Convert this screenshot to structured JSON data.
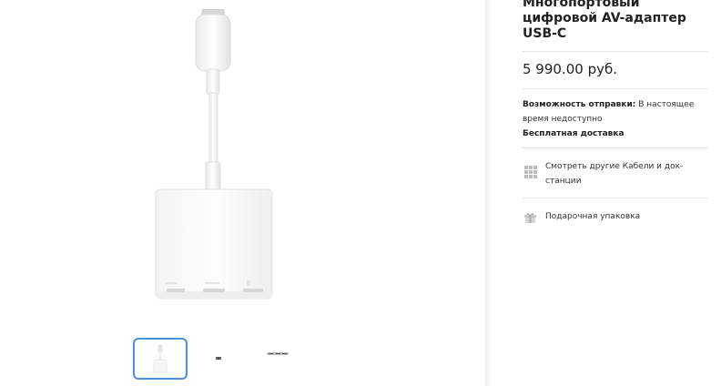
{
  "product": {
    "title_line1": "Многопортовый",
    "title_line2": "цифровой AV-адаптер",
    "title_line3": "USB-C",
    "price": "5 990.00 руб.",
    "shipping_label": "Возможность отправки:",
    "shipping_value_1": "В настоящее",
    "shipping_value_2": "время недоступно",
    "free_delivery": "Бесплатная доставка",
    "browse_link_1": "Смотреть другие Кабели и док-",
    "browse_link_2": "станции",
    "gift_wrap": "Подарочная упаковка"
  },
  "gallery": {
    "thumbnails": [
      "front-view",
      "side-view",
      "ports-view"
    ],
    "selected_index": 0
  },
  "colors": {
    "accent": "#4a90d9",
    "text": "#333333",
    "separator": "#e5e5e5"
  }
}
